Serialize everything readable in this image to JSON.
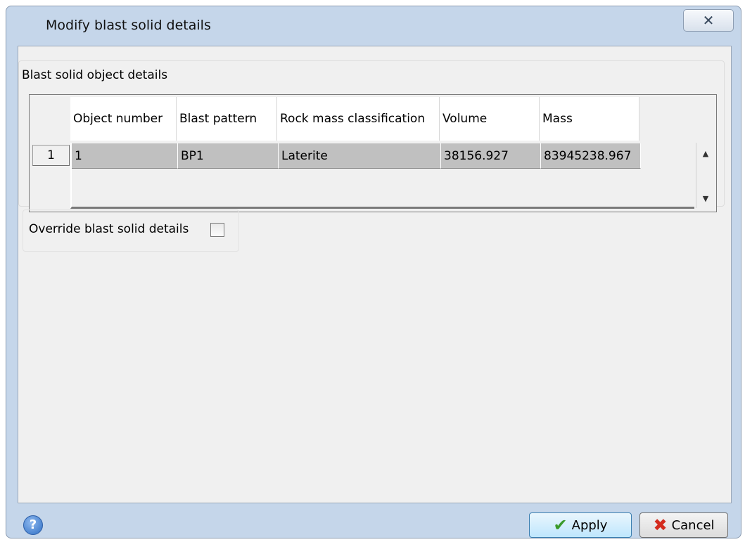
{
  "window": {
    "title": "Modify blast solid details",
    "close_glyph": "✕"
  },
  "group": {
    "title": "Blast solid object details"
  },
  "grid": {
    "columns": [
      "Object number",
      "Blast pattern",
      "Rock mass classification",
      "Volume",
      "Mass"
    ],
    "rows": [
      {
        "row_number": "1",
        "cells": [
          "1",
          "BP1",
          "Laterite",
          "38156.927",
          "83945238.967"
        ]
      }
    ],
    "scroll_up_glyph": "▲",
    "scroll_down_glyph": "▼"
  },
  "override": {
    "label": "Override blast solid details",
    "checked": false
  },
  "footer": {
    "help_glyph": "?",
    "apply_label": "Apply",
    "cancel_label": "Cancel",
    "apply_icon": "check-icon",
    "cancel_icon": "x-icon"
  },
  "colors": {
    "window_frame": "#c5d6ea",
    "client_bg": "#f0f0f0",
    "row_bg": "#c0c0c0",
    "apply_accent": "#bee6fd"
  }
}
